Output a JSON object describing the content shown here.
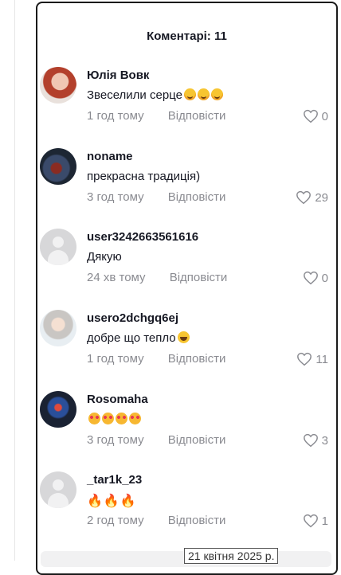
{
  "comments_panel": {
    "title": "Коментарі: 11",
    "reply_label": "Відповісти",
    "comments": [
      {
        "username": "Юлія Вовк",
        "text": "Звеселили серце",
        "emojis": [
          "blush-emoji",
          "blush-emoji",
          "blush-emoji"
        ],
        "time": "1 год тому",
        "likes": "0"
      },
      {
        "username": "noname",
        "text": "прекрасна традиція)",
        "emojis": [],
        "time": "3 год тому",
        "likes": "29"
      },
      {
        "username": "user3242663561616",
        "text": "Дякую",
        "emojis": [],
        "time": "24 хв тому",
        "likes": "0"
      },
      {
        "username": "usero2dchgq6ej",
        "text": "добре що тепло",
        "emojis": [
          "laughing-emoji"
        ],
        "time": "1 год тому",
        "likes": "11"
      },
      {
        "username": "Rosomaha",
        "text": "",
        "emojis": [
          "heart-eyes-emoji",
          "heart-eyes-emoji",
          "heart-eyes-emoji",
          "heart-eyes-emoji"
        ],
        "time": "3 год тому",
        "likes": "3"
      },
      {
        "username": "_tar1k_23",
        "text": "",
        "emojis": [
          "fire-emoji",
          "fire-emoji",
          "fire-emoji"
        ],
        "time": "2 год тому",
        "likes": "1"
      }
    ]
  },
  "date_tooltip": "21 квітня 2025 р."
}
